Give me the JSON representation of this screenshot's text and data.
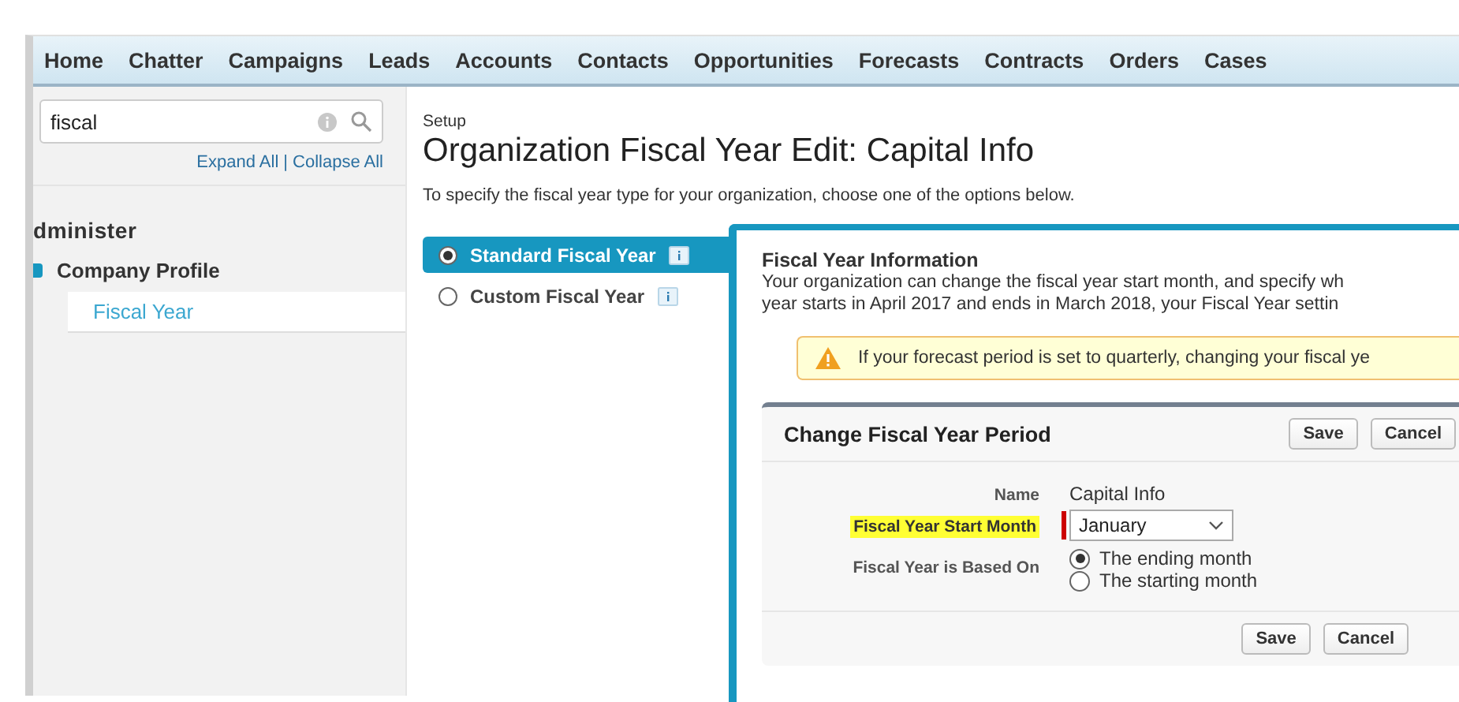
{
  "nav": {
    "tabs": [
      {
        "label": "Home",
        "selected": false
      },
      {
        "label": "Chatter",
        "selected": false
      },
      {
        "label": "Campaigns",
        "selected": false
      },
      {
        "label": "Leads",
        "selected": false
      },
      {
        "label": "Accounts",
        "selected": false
      },
      {
        "label": "Contacts",
        "selected": false
      },
      {
        "label": "Opportunities",
        "selected": false
      },
      {
        "label": "Forecasts",
        "selected": false
      },
      {
        "label": "Contracts",
        "selected": false
      },
      {
        "label": "Orders",
        "selected": false
      },
      {
        "label": "Cases",
        "selected": false
      }
    ]
  },
  "sidebar": {
    "search": {
      "value": "fiscal"
    },
    "expand_all": "Expand All",
    "separator": "|",
    "collapse_all": "Collapse All",
    "section": "dminister",
    "items": [
      {
        "label": "Company Profile",
        "expanded": true,
        "children": [
          {
            "label": "Fiscal Year",
            "selected": true
          }
        ]
      }
    ]
  },
  "header": {
    "breadcrumb": "Setup",
    "title": "Organization Fiscal Year Edit: Capital Info",
    "instructions": "To specify the fiscal year type for your organization, choose one of the options below."
  },
  "options": [
    {
      "label": "Standard Fiscal Year",
      "selected": true
    },
    {
      "label": "Custom Fiscal Year",
      "selected": false
    }
  ],
  "info": {
    "title": "Fiscal Year Information",
    "lines": [
      "Your organization can change the fiscal year start month, and specify wh",
      "year starts in April 2017 and ends in March 2018, your Fiscal Year settin"
    ],
    "warning": "If your forecast period is set to quarterly, changing your fiscal ye"
  },
  "form": {
    "title": "Change Fiscal Year Period",
    "buttons": [
      "Save",
      "Cancel"
    ],
    "fields": [
      {
        "kind": "text",
        "label": "Name",
        "value": "Capital Info",
        "highlighted": false,
        "required": false
      },
      {
        "kind": "select",
        "label": "Fiscal Year Start Month",
        "value": "January",
        "highlighted": true,
        "required": true
      },
      {
        "kind": "radio",
        "label": "Fiscal Year is Based On",
        "highlighted": false,
        "required": false,
        "choices": [
          {
            "label": "The ending month",
            "selected": true
          },
          {
            "label": "The starting month",
            "selected": false
          }
        ]
      }
    ],
    "footer_buttons": [
      "Save",
      "Cancel"
    ]
  }
}
